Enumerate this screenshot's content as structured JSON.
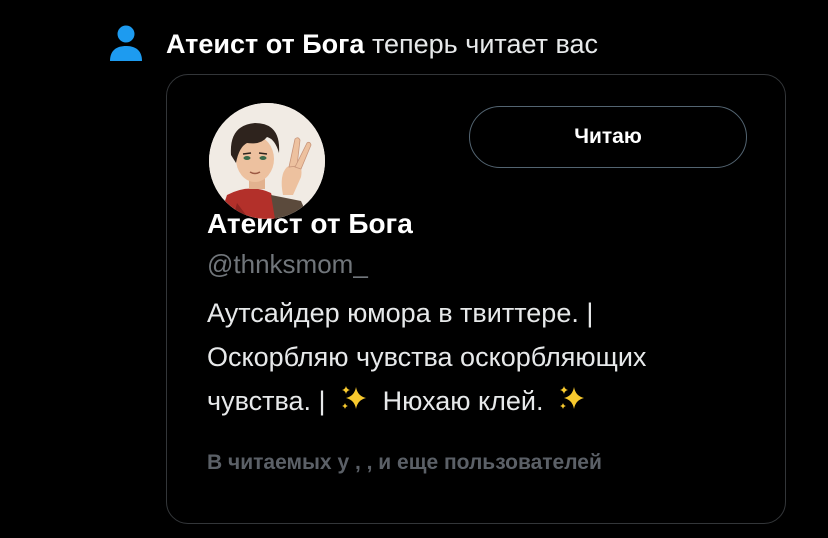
{
  "notification": {
    "icon": "person-icon",
    "name": "Атеист от Бога",
    "action": "теперь читает вас",
    "accent_color": "#1d9bf0"
  },
  "user_card": {
    "avatar": "avatar",
    "follow_button_label": "Читаю",
    "display_name": "Атеист от Бога",
    "handle": "@thnksmom_",
    "bio": {
      "line1": "Аутсайдер юмора в твиттере. |",
      "line2": "Оскорбляю чувства оскорбляющих",
      "line3_a": "чувства. |",
      "line3_b": "Нюхаю клей.",
      "sparkle_icon": "sparkles-icon"
    },
    "followed_by": "В читаемых у , , и еще пользователей"
  }
}
